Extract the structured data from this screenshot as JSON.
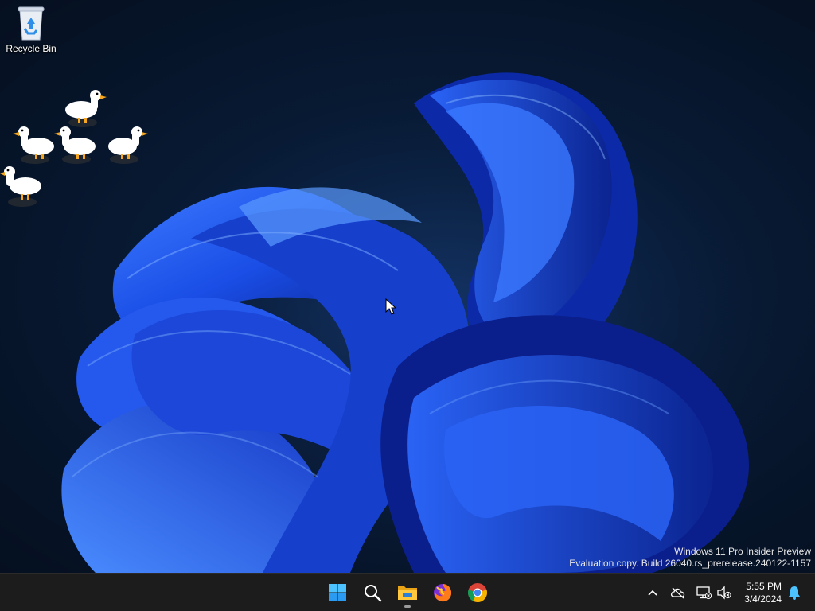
{
  "desktop": {
    "recycle_bin_label": "Recycle Bin",
    "watermark": {
      "line1": "Windows 11 Pro Insider Preview",
      "line2": "Evaluation copy. Build 26040.rs_prerelease.240122-1157"
    }
  },
  "taskbar": {
    "apps": [
      {
        "name": "start-button",
        "icon": "windows-logo-icon"
      },
      {
        "name": "search-button",
        "icon": "search-icon"
      },
      {
        "name": "file-explorer-button",
        "icon": "folder-icon",
        "running": true
      },
      {
        "name": "firefox-button",
        "icon": "firefox-icon"
      },
      {
        "name": "chrome-button",
        "icon": "chrome-icon"
      }
    ],
    "tray": {
      "time": "5:55 PM",
      "date": "3/4/2024"
    }
  },
  "colors": {
    "taskbar_bg": "#1c1c1c",
    "accent": "#2a7de1",
    "wallpaper_blue": "#1f4fe0"
  }
}
